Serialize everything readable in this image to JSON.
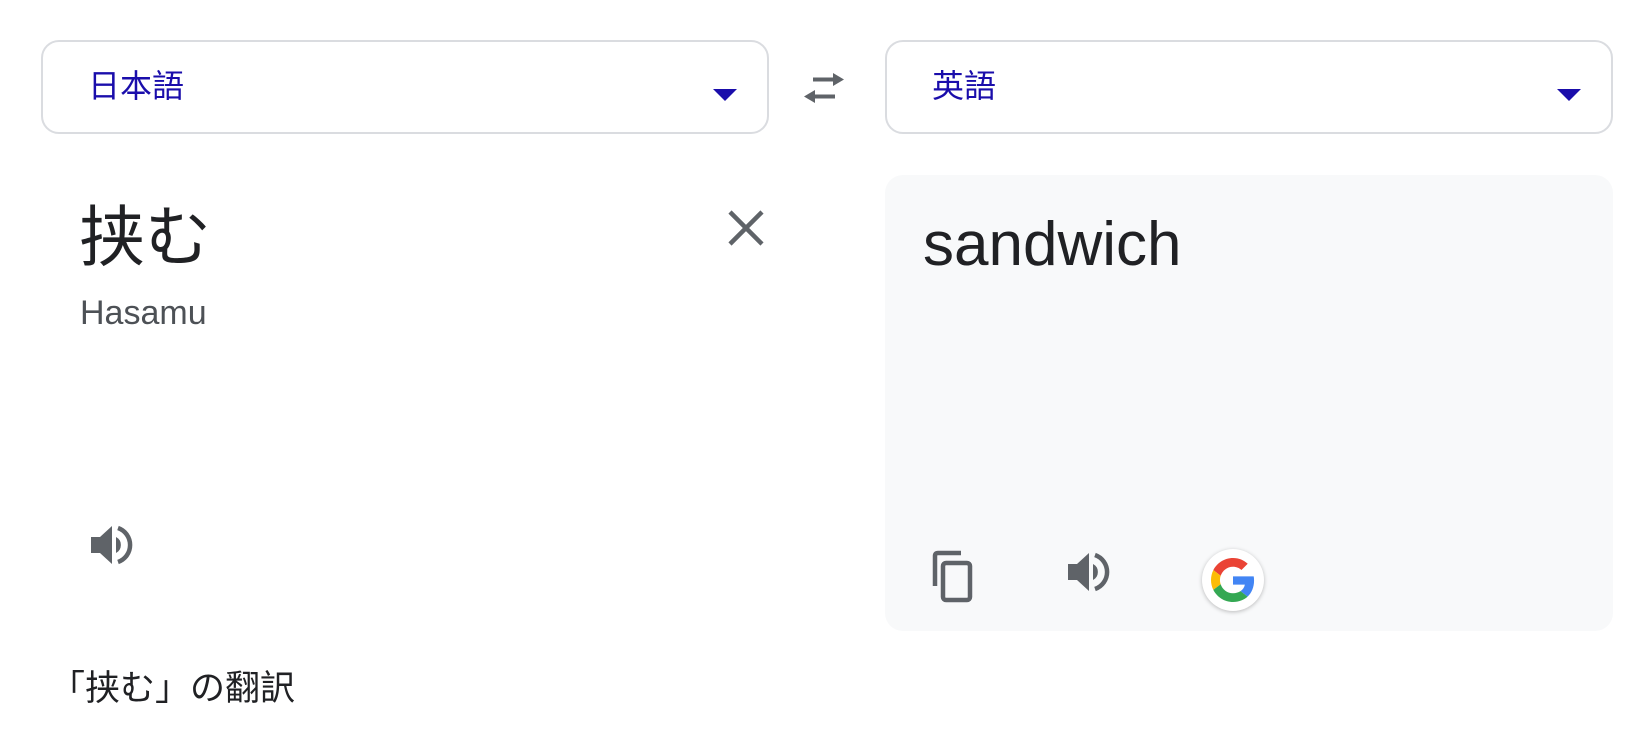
{
  "source_language": {
    "label": "日本語",
    "icon": "chevron-down-icon"
  },
  "target_language": {
    "label": "英語",
    "icon": "chevron-down-icon"
  },
  "swap": {
    "icon": "swap-arrows-icon"
  },
  "source": {
    "text": "挟む",
    "romanization": "Hasamu",
    "clear_icon": "close-icon",
    "speaker_icon": "speaker-icon"
  },
  "target": {
    "text": "sandwich",
    "copy_icon": "copy-icon",
    "speaker_icon": "speaker-icon",
    "google_icon": "google-logo-icon"
  },
  "footer": {
    "link_text": "「挟む」の翻訳"
  },
  "colors": {
    "accent": "#1a0dab",
    "border": "#dadce0",
    "panel_background": "#f8f9fa",
    "icon_gray": "#5f6368",
    "text": "#202124"
  }
}
